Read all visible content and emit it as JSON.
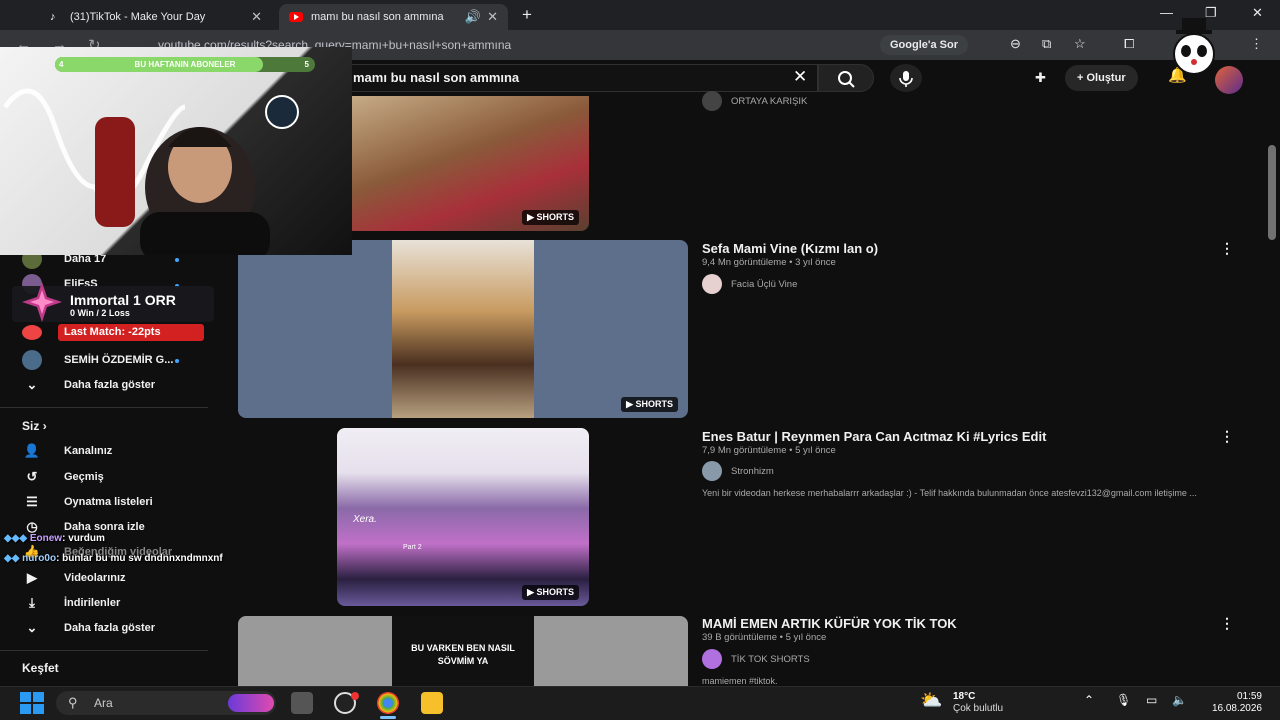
{
  "browser": {
    "tabs": [
      {
        "title": "(31)TikTok - Make Your Day"
      },
      {
        "title": "mamı bu nasıl son ammına"
      }
    ],
    "url": "youtube.com/results?search_query=mamı+bu+nasıl+son+ammına",
    "google_sor_label": "Google'a Sor"
  },
  "youtube": {
    "search_query": "mamı bu nasıl son ammına",
    "create_label": "Oluştur"
  },
  "sidebar": {
    "subscriptions": [
      {
        "label": "Daha 17"
      },
      {
        "label": "EliFsS"
      },
      {
        "label": "SEMİH ÖZDEMİR G..."
      }
    ],
    "show_more_1": "Daha fazla göster",
    "you_section": "Siz",
    "you_items": [
      {
        "label": "Kanalınız",
        "icon": "channel-icon"
      },
      {
        "label": "Geçmiş",
        "icon": "history-icon"
      },
      {
        "label": "Oynatma listeleri",
        "icon": "playlists-icon"
      },
      {
        "label": "Daha sonra izle",
        "icon": "watch-later-icon"
      },
      {
        "label": "Beğendiğim videolar",
        "icon": "liked-icon"
      },
      {
        "label": "Videolarınız",
        "icon": "your-videos-icon"
      },
      {
        "label": "İndirilenler",
        "icon": "downloads-icon"
      }
    ],
    "show_more_2": "Daha fazla göster",
    "explore_section": "Keşfet"
  },
  "results": [
    {
      "title": "",
      "channel": "ORTAYA KARIŞIK",
      "badge": "SHORTS"
    },
    {
      "title": "Sefa Mami Vine (Kızmı lan o)",
      "meta": "9,4 Mn görüntüleme • 3 yıl önce",
      "channel": "Facia Üçlü Vine",
      "badge": "SHORTS"
    },
    {
      "title": "Enes Batur | Reynmen Para Can Acıtmaz Ki #Lyrics Edit",
      "meta": "7,9 Mn görüntüleme • 5 yıl önce",
      "channel": "Stronhizm",
      "desc": "Yeni bir videodan herkese merhabalarrr arkadaşlar :) - Telif hakkında bulunmadan önce atesfevzi132@gmail.com iletişime ...",
      "badge": "SHORTS",
      "thumb_text_1": "Xera.",
      "thumb_text_2": "Part 2"
    },
    {
      "title": "MAMİ EMEN ARTIK KÜFÜR YOK TİK TOK",
      "meta": "39 B görüntüleme • 5 yıl önce",
      "channel": "TİK TOK SHORTS",
      "desc": "mamiemen #tiktok.",
      "thumb_text": "BU VARKEN BEN NASIL SÖVMİM YA"
    }
  ],
  "overlay": {
    "sub_goal_label": "BU HAFTANIN ABONELER",
    "sub_goal_left": "4",
    "sub_goal_right": "5",
    "sub_goal_progress": 0.8,
    "rank_name": "Immortal 1  ORR",
    "rank_record": "0 Win / 2 Loss",
    "last_match": "Last Match: -22pts",
    "chat": [
      {
        "user": "Eonew",
        "message": ": vurdum"
      },
      {
        "user": "nuro0o",
        "message": ": bunlar bu mu sw dndnnxndmnxnf"
      }
    ]
  },
  "taskbar": {
    "search_placeholder": "Ara",
    "weather_temp": "18°C",
    "weather_desc": "Çok bulutlu",
    "time": "01:59",
    "date": "16.08.2026"
  },
  "colors": {
    "yt_background": "#0f0f0f",
    "last_match_red": "#d32020",
    "sub_bar_green": "#8bd86a"
  }
}
